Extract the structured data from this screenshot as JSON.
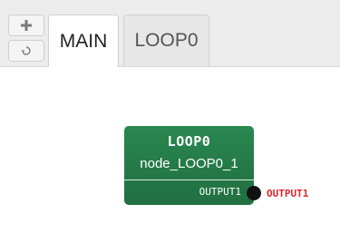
{
  "toolbar": {
    "add_icon": "plus-icon",
    "refresh_icon": "refresh-icon"
  },
  "tabs": [
    {
      "label": "MAIN",
      "active": true
    },
    {
      "label": "LOOP0",
      "active": false
    }
  ],
  "node": {
    "title": "LOOP0",
    "subtitle": "node_LOOP0_1",
    "port_label": "OUTPUT1",
    "color": "#237a46"
  },
  "output": {
    "label": "OUTPUT1",
    "color": "#e0232b"
  }
}
